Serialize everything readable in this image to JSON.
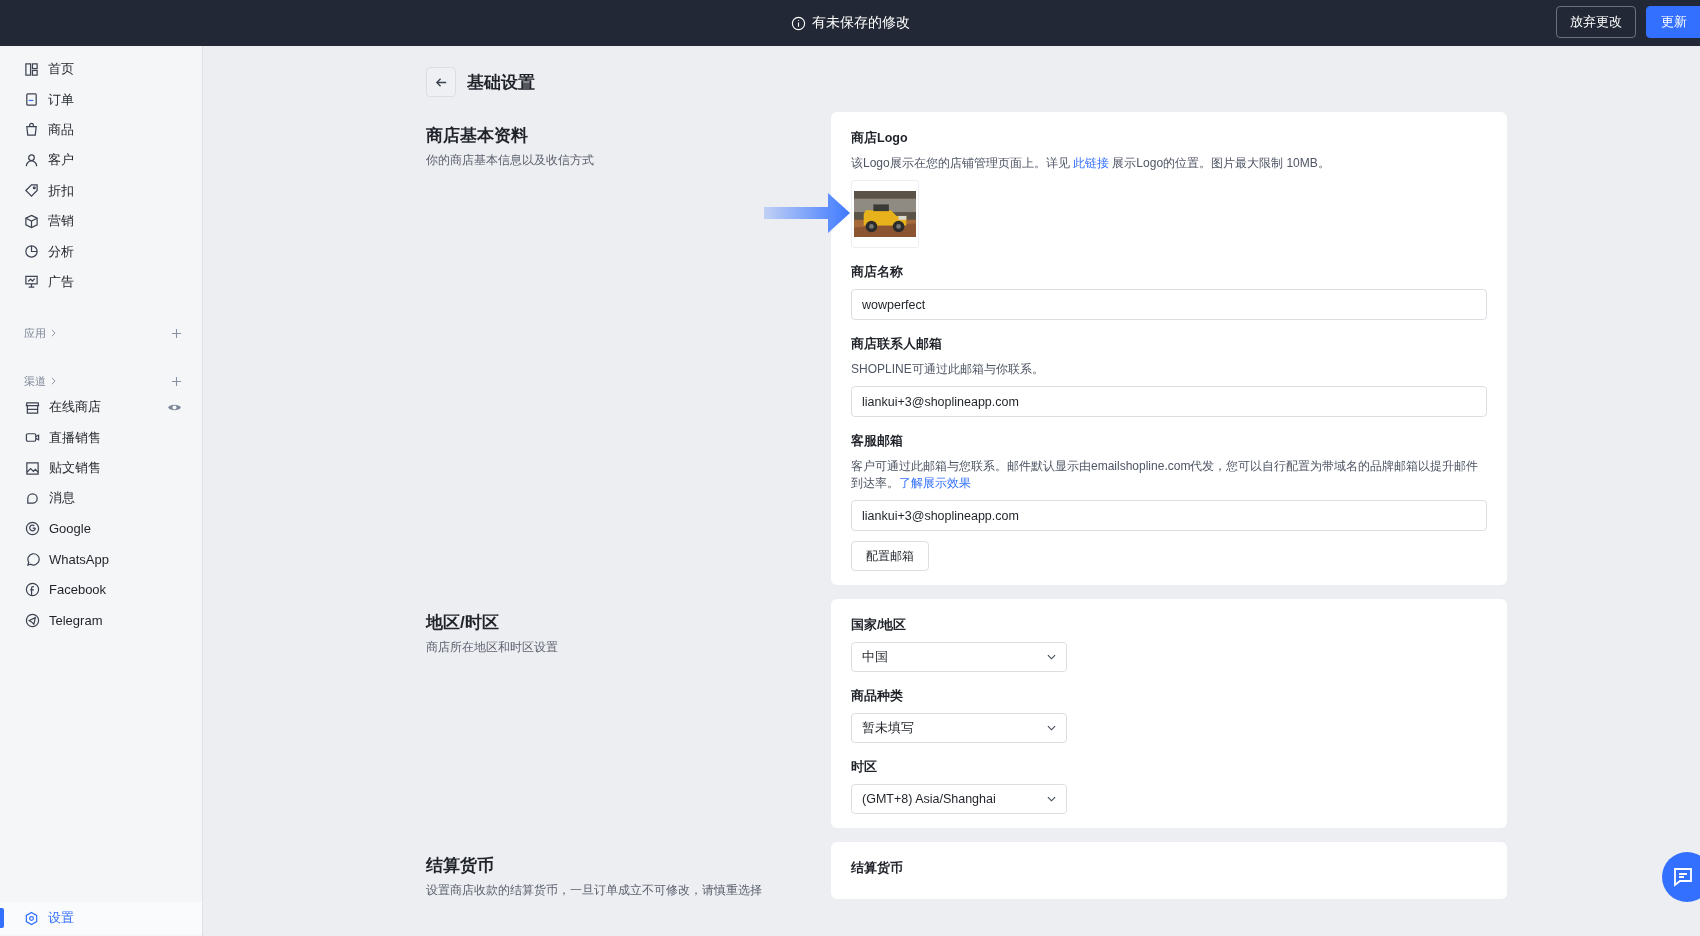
{
  "topbar": {
    "notice": "有未保存的修改",
    "buttons": [
      {
        "label": "放弃更改",
        "kind": "secondary"
      },
      {
        "label": "更新",
        "kind": "primary"
      }
    ]
  },
  "sidebar": {
    "items": [
      {
        "label": "首页",
        "selected": false
      },
      {
        "label": "订单",
        "selected": false
      },
      {
        "label": "商品",
        "selected": false
      },
      {
        "label": "客户",
        "selected": false
      },
      {
        "label": "折扣",
        "selected": false
      },
      {
        "label": "营销",
        "selected": false
      },
      {
        "label": "分析",
        "selected": false
      },
      {
        "label": "广告",
        "selected": false
      }
    ],
    "apps": {
      "label": "应用"
    },
    "channels": {
      "label": "渠道",
      "items": [
        {
          "label": "在线商店",
          "selected": false,
          "visible": true
        },
        {
          "label": "直播销售",
          "selected": false,
          "visible": false
        },
        {
          "label": "贴文销售",
          "selected": false,
          "visible": false
        },
        {
          "label": "消息",
          "selected": false,
          "visible": false
        },
        {
          "label": "Google",
          "selected": false,
          "visible": false
        },
        {
          "label": "WhatsApp",
          "selected": false,
          "visible": false
        },
        {
          "label": "Facebook",
          "selected": false,
          "visible": false
        },
        {
          "label": "Telegram",
          "selected": false,
          "visible": false
        }
      ]
    },
    "settings": {
      "label": "设置",
      "selected": true
    }
  },
  "page": {
    "title": "基础设置"
  },
  "sections": [
    {
      "title": "商店基本资料",
      "description": "你的商店基本信息以及收信方式",
      "fields": [
        {
          "kind": "logo",
          "label": "商店Logo",
          "help_before": "该Logo展示在您的店铺管理页面上。详见 ",
          "link": "此链接",
          "help_after": " 展示Logo的位置。图片最大限制 10MB。"
        },
        {
          "kind": "text",
          "label": "商店名称",
          "value": "wowperfect"
        },
        {
          "kind": "text",
          "label": "商店联系人邮箱",
          "help_before": "SHOPLINE可通过此邮箱与你联系。",
          "value": "liankui+3@shoplineapp.com"
        },
        {
          "kind": "text",
          "label": "客服邮箱",
          "help_before": "客户可通过此邮箱与您联系。邮件默认显示由emailshopline.com代发，您可以自行配置为带域名的品牌邮箱以提升邮件到达率。",
          "link": "了解展示效果",
          "value": "liankui+3@shoplineapp.com",
          "button": "配置邮箱"
        }
      ]
    },
    {
      "title": "地区/时区",
      "description": "商店所在地区和时区设置",
      "fields": [
        {
          "kind": "select",
          "label": "国家/地区",
          "value": "中国"
        },
        {
          "kind": "select",
          "label": "商品种类",
          "value": "暂未填写"
        },
        {
          "kind": "select",
          "label": "时区",
          "value": "(GMT+8) Asia/Shanghai"
        }
      ]
    },
    {
      "title": "结算货币",
      "description": "设置商店收款的结算货币，一旦订单成立不可修改，请慎重选择",
      "fields": [
        {
          "kind": "heading",
          "label": "结算货币"
        }
      ]
    }
  ]
}
